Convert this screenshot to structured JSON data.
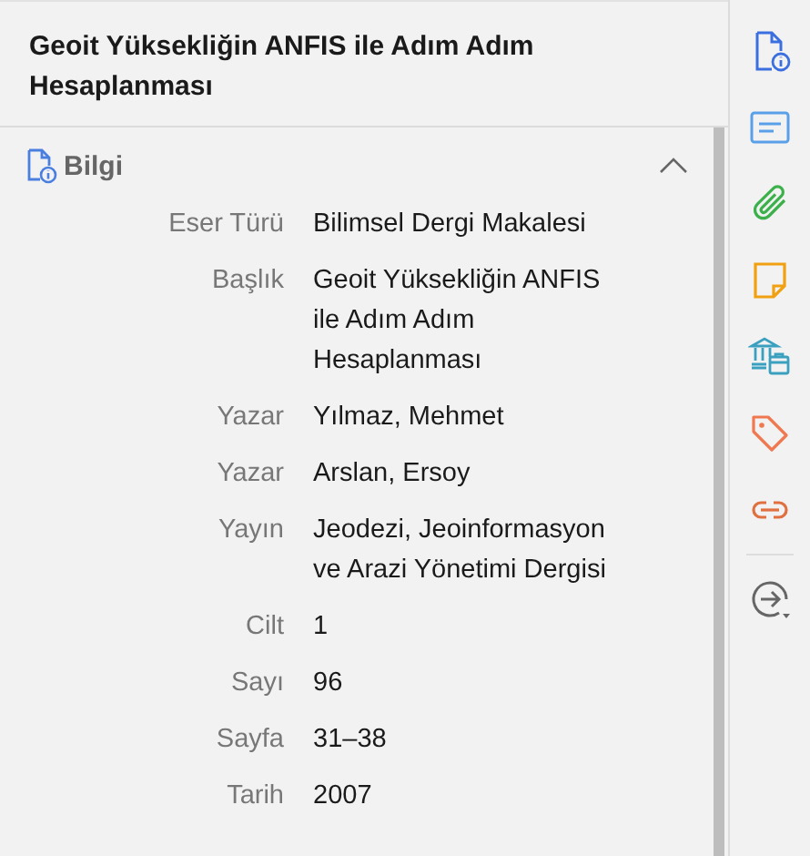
{
  "item_title": "Geoit Yüksekliğin ANFIS ile Adım Adım Hesaplanması",
  "section": {
    "title": "Bilgi",
    "expanded": true
  },
  "fields": [
    {
      "label": "Eser Türü",
      "value": "Bilimsel Dergi Makalesi"
    },
    {
      "label": "Başlık",
      "value": "Geoit Yüksekliğin ANFIS ile Adım Adım Hesaplanması"
    },
    {
      "label": "Yazar",
      "value": "Yılmaz, Mehmet"
    },
    {
      "label": "Yazar",
      "value": "Arslan, Ersoy"
    },
    {
      "label": "Yayın",
      "value": "Jeodezi, Jeoinformasyon ve Arazi Yönetimi Dergisi"
    },
    {
      "label": "Cilt",
      "value": "1"
    },
    {
      "label": "Sayı",
      "value": "96"
    },
    {
      "label": "Sayfa",
      "value": "31–38"
    },
    {
      "label": "Tarih",
      "value": "2007"
    }
  ]
}
